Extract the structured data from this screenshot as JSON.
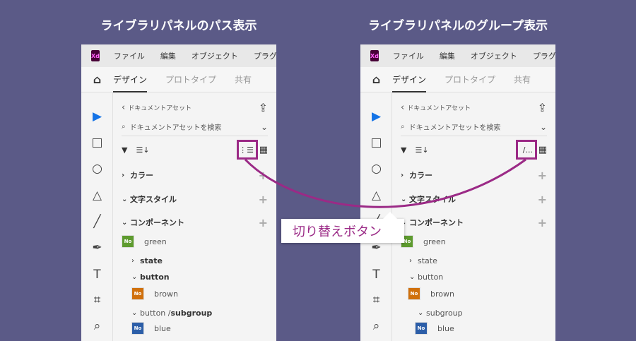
{
  "titles": [
    "ライブラリパネルのパス表示",
    "ライブラリパネルのグループ表示"
  ],
  "callout": "切り替えボタン",
  "accent": "#9b2a86",
  "panels": [
    {
      "logo": "Xd",
      "menu": [
        "ファイル",
        "編集",
        "オブジェクト",
        "プラグイン"
      ],
      "tabs": [
        "デザイン",
        "プロトタイプ",
        "共有"
      ],
      "back": "ドキュメントアセット",
      "search_placeholder": "ドキュメントアセットを検索",
      "view_icon": "list-path-icon",
      "sections": [
        "カラー",
        "文字スタイル",
        "コンポーネント"
      ],
      "items": [
        {
          "type": "comp",
          "label": "green",
          "color": "#5e9b2f",
          "indent": 0
        },
        {
          "type": "group",
          "label": "state",
          "open": false,
          "indent": 1,
          "bold": "state"
        },
        {
          "type": "group",
          "label": "button",
          "open": true,
          "indent": 1,
          "bold": "button"
        },
        {
          "type": "comp",
          "label": "brown",
          "color": "#d0700c",
          "indent": 1
        },
        {
          "type": "group",
          "label": "button / ",
          "bold": "subgroup",
          "open": true,
          "indent": 1
        },
        {
          "type": "comp",
          "label": "blue",
          "color": "#2c5ea8",
          "indent": 1
        }
      ]
    },
    {
      "logo": "Xd",
      "menu": [
        "ファイル",
        "編集",
        "オブジェクト",
        "プラグイン"
      ],
      "tabs": [
        "デザイン",
        "プロトタイプ",
        "共有"
      ],
      "back": "ドキュメントアセット",
      "search_placeholder": "ドキュメントアセットを検索",
      "view_icon": "path-slash-icon",
      "view_text": "/...",
      "sections": [
        "カラー",
        "文字スタイル",
        "コンポーネント"
      ],
      "items": [
        {
          "type": "comp",
          "label": "green",
          "color": "#5e9b2f",
          "indent": 0
        },
        {
          "type": "group",
          "label": "state",
          "open": false,
          "indent": 1
        },
        {
          "type": "group",
          "label": "button",
          "open": true,
          "indent": 1
        },
        {
          "type": "comp",
          "label": "brown",
          "color": "#d0700c",
          "indent": 1
        },
        {
          "type": "group",
          "label": "subgroup",
          "open": true,
          "indent": 2
        },
        {
          "type": "comp",
          "label": "blue",
          "color": "#2c5ea8",
          "indent": 2
        }
      ]
    }
  ],
  "swatch_text": "No"
}
